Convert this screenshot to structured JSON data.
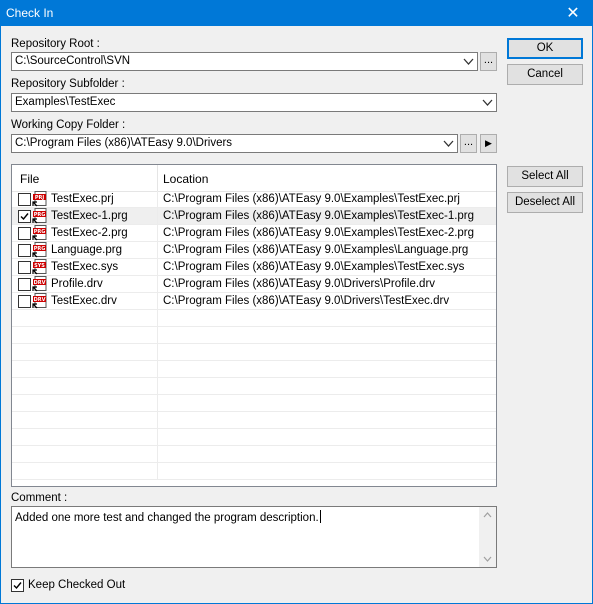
{
  "window": {
    "title": "Check In",
    "close_glyph": "✕"
  },
  "repo_root": {
    "label": "Repository Root :",
    "value": "C:\\SourceControl\\SVN",
    "browse_label": "..."
  },
  "repo_subfolder": {
    "label": "Repository Subfolder :",
    "value": "Examples\\TestExec"
  },
  "working_copy": {
    "label": "Working Copy Folder :",
    "value": "C:\\Program Files (x86)\\ATEasy 9.0\\Drivers",
    "browse_label": "...",
    "arrow_label": "▶"
  },
  "buttons": {
    "ok": "OK",
    "cancel": "Cancel",
    "select_all": "Select All",
    "deselect_all": "Deselect All"
  },
  "file_list": {
    "columns": [
      "File",
      "Location"
    ],
    "rows": [
      {
        "name": "TestExec.prj",
        "location": "C:\\Program Files (x86)\\ATEasy 9.0\\Examples\\TestExec.prj",
        "checked": false,
        "icon": "prj-file-icon",
        "badge": "PRJ"
      },
      {
        "name": "TestExec-1.prg",
        "location": "C:\\Program Files (x86)\\ATEasy 9.0\\Examples\\TestExec-1.prg",
        "checked": true,
        "icon": "prg-file-icon",
        "badge": "PRG"
      },
      {
        "name": "TestExec-2.prg",
        "location": "C:\\Program Files (x86)\\ATEasy 9.0\\Examples\\TestExec-2.prg",
        "checked": false,
        "icon": "prg-file-icon",
        "badge": "PRG"
      },
      {
        "name": "Language.prg",
        "location": "C:\\Program Files (x86)\\ATEasy 9.0\\Examples\\Language.prg",
        "checked": false,
        "icon": "prg-file-icon",
        "badge": "PRG"
      },
      {
        "name": "TestExec.sys",
        "location": "C:\\Program Files (x86)\\ATEasy 9.0\\Examples\\TestExec.sys",
        "checked": false,
        "icon": "sys-file-icon",
        "badge": "SYS"
      },
      {
        "name": "Profile.drv",
        "location": "C:\\Program Files (x86)\\ATEasy 9.0\\Drivers\\Profile.drv",
        "checked": false,
        "icon": "drv-file-icon",
        "badge": "DRV"
      },
      {
        "name": "TestExec.drv",
        "location": "C:\\Program Files (x86)\\ATEasy 9.0\\Drivers\\TestExec.drv",
        "checked": false,
        "icon": "drv-file-icon",
        "badge": "DRV"
      }
    ]
  },
  "comment": {
    "label": "Comment :",
    "value": "Added one more test and changed the program description."
  },
  "keep_checked_out": {
    "label": "Keep Checked Out",
    "checked": true
  },
  "colors": {
    "titlebar": "#0078d7",
    "badge_red": "#cc0000",
    "selection": "#efefef"
  }
}
